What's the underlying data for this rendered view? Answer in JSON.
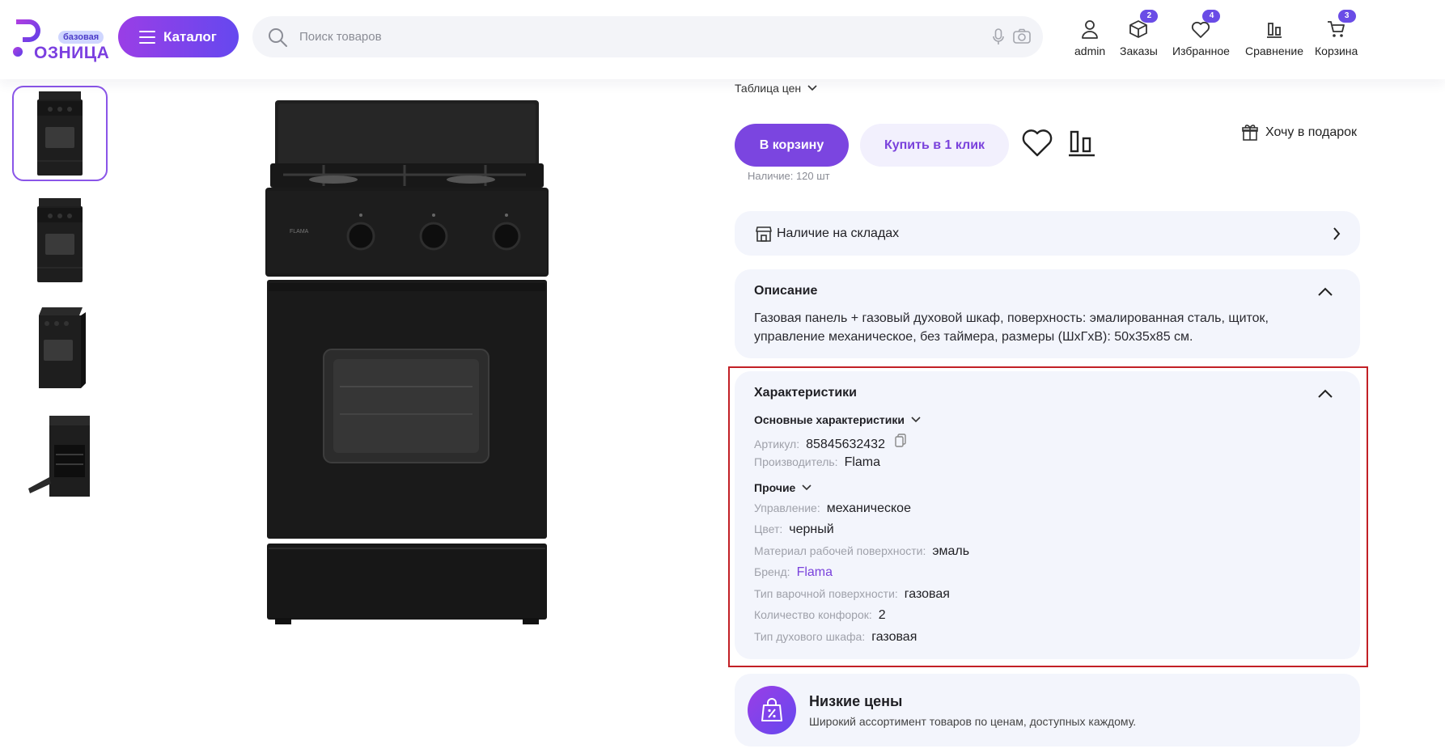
{
  "header": {
    "logo_badge": "базовая",
    "logo_text": "ОЗНИЦА",
    "catalog_label": "Каталог",
    "search_placeholder": "Поиск товаров",
    "nav": [
      {
        "id": "account",
        "label": "admin",
        "icon": "user-icon",
        "badge": ""
      },
      {
        "id": "orders",
        "label": "Заказы",
        "icon": "box-icon",
        "badge": "2"
      },
      {
        "id": "favorites",
        "label": "Избранное",
        "icon": "heart-icon",
        "badge": "4"
      },
      {
        "id": "compare",
        "label": "Сравнение",
        "icon": "compare-icon",
        "badge": ""
      },
      {
        "id": "cart",
        "label": "Корзина",
        "icon": "cart-icon",
        "badge": "3"
      }
    ]
  },
  "gallery": {
    "thumbnails": [
      "stove-front",
      "stove-front-alt",
      "stove-angle",
      "stove-open-oven"
    ],
    "active_index": 0
  },
  "product": {
    "price_table_label": "Таблица цен",
    "add_to_cart_label": "В корзину",
    "buy_one_click_label": "Купить в 1 клик",
    "gift_label": "Хочу в подарок",
    "stock_text": "Наличие: 120 шт",
    "warehouse_label": "Наличие на складах",
    "description": {
      "title": "Описание",
      "text": "Газовая панель + газовый духовой шкаф, поверхность: эмалированная сталь, щиток, управление механическое, без таймера, размеры (ШхГхВ): 50x35x85 см."
    },
    "specs": {
      "title": "Характеристики",
      "groups": [
        {
          "title": "Основные характеристики",
          "rows": [
            {
              "key": "Артикул:",
              "value": "85845632432"
            },
            {
              "key": "Производитель:",
              "value": "Flama"
            }
          ]
        },
        {
          "title": "Прочие",
          "rows": [
            {
              "key": "Управление:",
              "value": "механическое"
            },
            {
              "key": "Цвет:",
              "value": "черный"
            },
            {
              "key": "Материал рабочей поверхности:",
              "value": "эмаль"
            },
            {
              "key": "Бренд:",
              "value": "Flama"
            },
            {
              "key": "Тип варочной поверхности:",
              "value": "газовая"
            },
            {
              "key": "Количество конфорок:",
              "value": "2"
            },
            {
              "key": "Тип духового шкафа:",
              "value": "газовая"
            }
          ]
        }
      ]
    },
    "promo": {
      "title": "Низкие цены",
      "subtitle": "Широкий ассортимент товаров по ценам, доступных каждому."
    }
  },
  "colors": {
    "accent": "#7b45e0",
    "gradient_start": "#9a3ee6",
    "gradient_end": "#6548ef",
    "card_bg": "#f3f5fc",
    "highlight_outline": "#c22026"
  }
}
